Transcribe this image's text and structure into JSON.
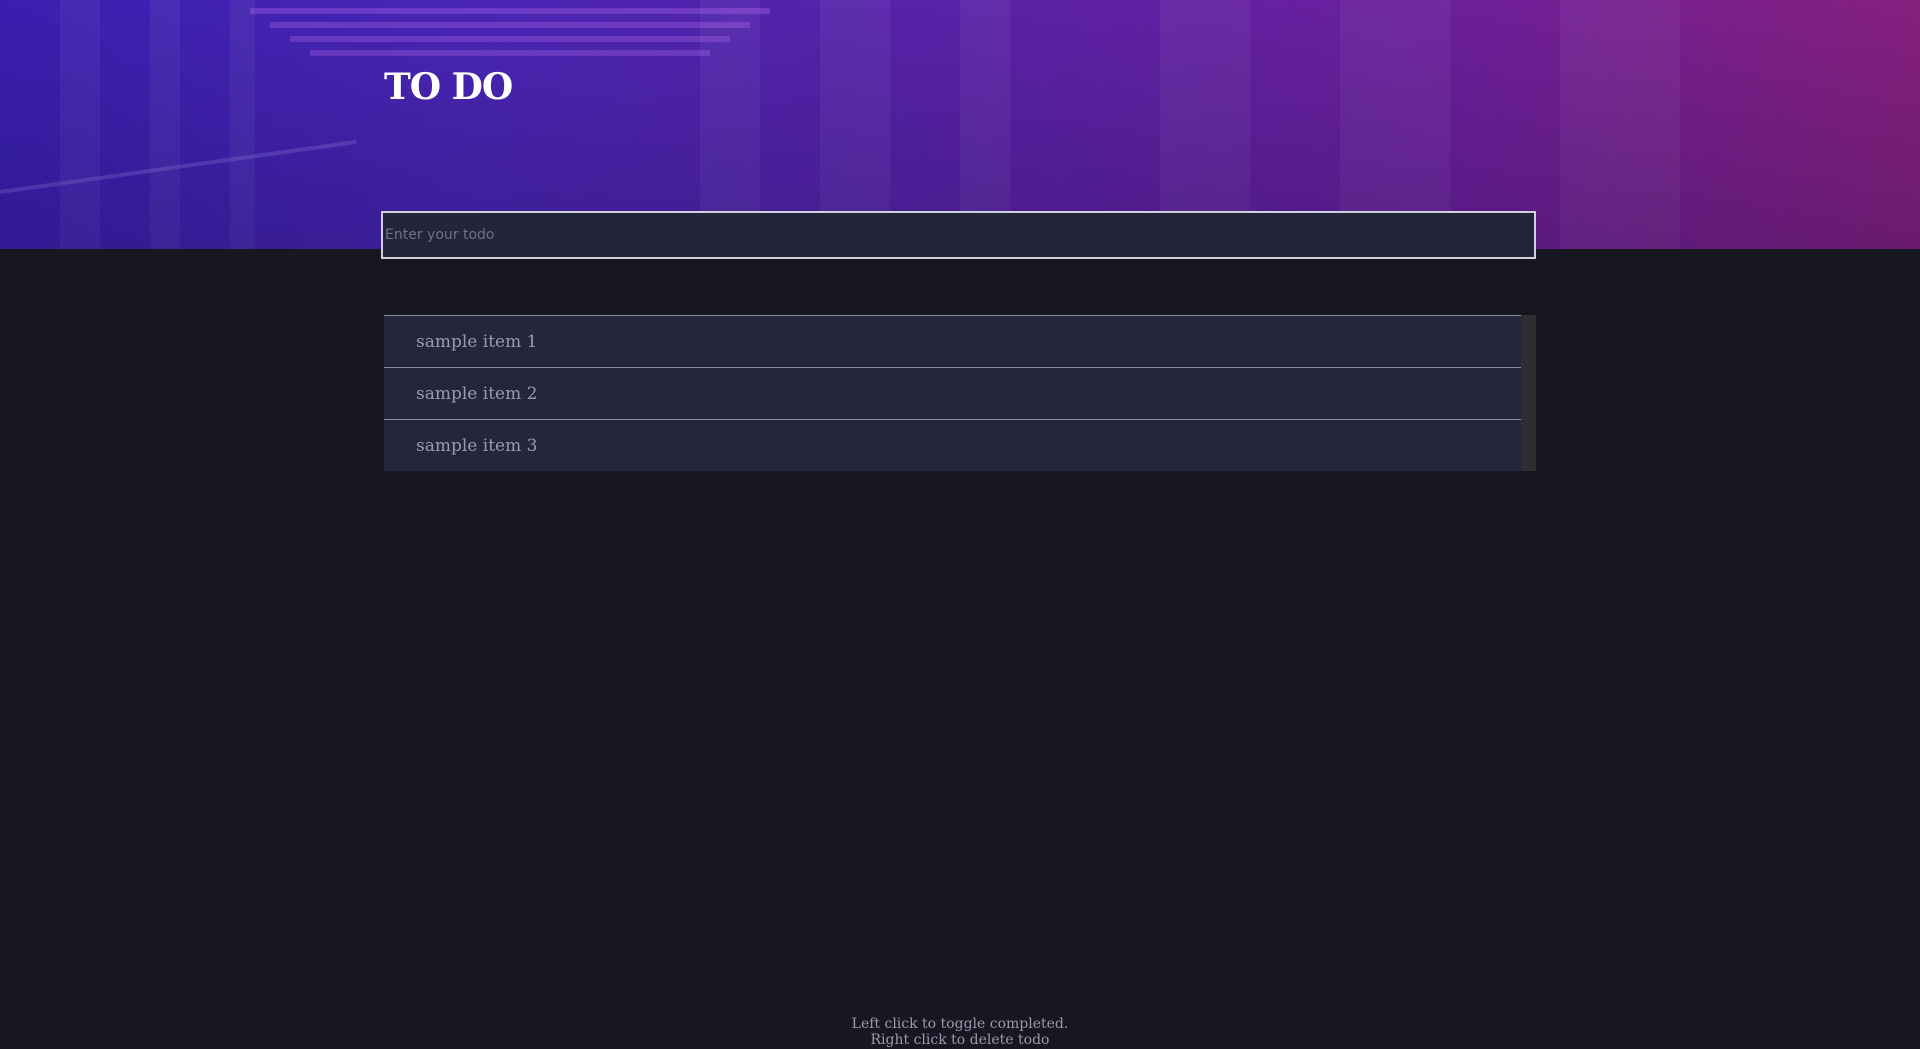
{
  "header": {
    "title": "TO DO"
  },
  "input": {
    "placeholder": "Enter your todo",
    "value": ""
  },
  "todos": [
    {
      "label": "sample item 1",
      "completed": false
    },
    {
      "label": "sample item 2",
      "completed": false
    },
    {
      "label": "sample item 3",
      "completed": false
    }
  ],
  "footer": {
    "line1": "Left click to toggle completed.",
    "line2": "Right click to delete todo"
  },
  "colors": {
    "background": "#171722",
    "item_background": "#25263b",
    "gradient_start": "#3a1fb0",
    "gradient_end": "#86207e"
  }
}
